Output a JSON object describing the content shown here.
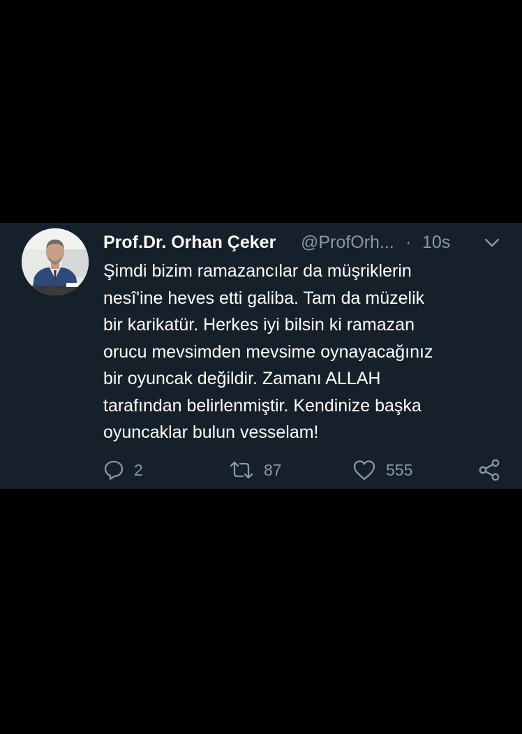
{
  "tweet": {
    "display_name": "Prof.Dr. Orhan Çeker",
    "handle": "@ProfOrh...",
    "separator": "·",
    "time": "10s",
    "text_lines": [
      "Şimdi bizim ramazancılar da müşriklerin",
      "nesî'ine heves etti galiba. Tam da müzelik",
      "bir karikatür. Herkes iyi bilsin ki ramazan",
      "orucu mevsimden mevsime oynayacağınız",
      "bir oyuncak değildir. Zamanı ALLAH",
      "tarafından belirlenmiştir. Kendinize başka",
      "oyuncaklar bulun vesselam!"
    ],
    "actions": {
      "reply_icon": "reply-icon",
      "reply_count": "2",
      "retweet_icon": "retweet-icon",
      "retweet_count": "87",
      "like_icon": "heart-icon",
      "like_count": "555",
      "share_icon": "share-icon"
    },
    "menu_icon": "chevron-down-icon"
  },
  "colors": {
    "background": "#000000",
    "card": "#15202b",
    "text_primary": "#ffffff",
    "text_secondary": "#8899a6"
  }
}
